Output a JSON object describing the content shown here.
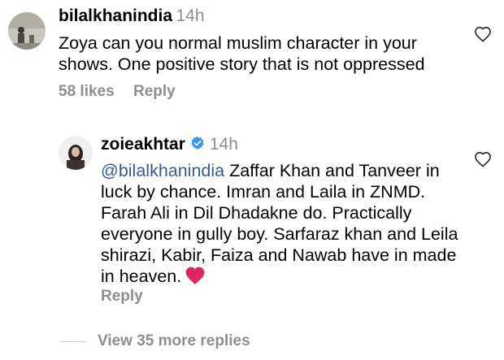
{
  "comments": [
    {
      "username": "bilalkhanindia",
      "time": "14h",
      "text": "Zoya can you normal  muslim character in your shows. One positive story that is not oppressed",
      "likes": "58 likes",
      "reply_label": "Reply"
    }
  ],
  "reply": {
    "username": "zoieakhtar",
    "time": "14h",
    "mention": "@bilalkhanindia",
    "text": " Zaffar Khan and Tanveer in luck by chance. Imran and Laila in ZNMD. Farah Ali in Dil Dhadakne do. Practically everyone in gully boy. Sarfaraz khan and Leila shirazi, Kabir, Faiza and Nawab have in made in heaven.",
    "reply_label": "Reply"
  },
  "view_more_label": "View 35 more replies",
  "icons": {
    "like": "heart-outline-icon",
    "verified": "verified-badge-icon",
    "emoji": "red-heart-emoji"
  },
  "colors": {
    "mention": "#385898",
    "secondary": "#8e8e8e",
    "verified": "#3897f0",
    "heart": "#e0245e"
  }
}
